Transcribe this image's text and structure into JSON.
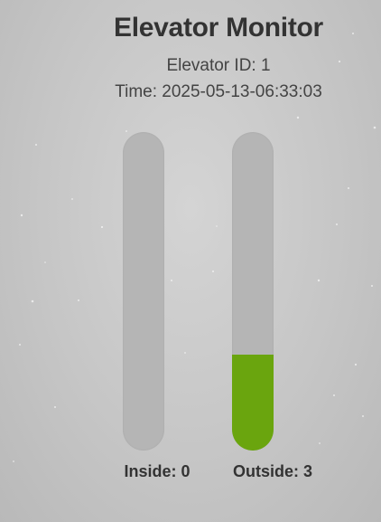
{
  "header": {
    "title": "Elevator Monitor",
    "elevator_id_text": "Elevator ID: 1",
    "time_text": "Time: 2025-05-13-06:33:03"
  },
  "gauges": {
    "max_capacity": 10,
    "inside": {
      "label": "Inside: 0",
      "count": 0,
      "fill_fraction": 0.0
    },
    "outside": {
      "label": "Outside: 3",
      "count": 3,
      "fill_fraction": 0.3
    }
  },
  "colors": {
    "fill": "#6aa50e",
    "track": "#b5b5b5",
    "text": "#333333"
  }
}
